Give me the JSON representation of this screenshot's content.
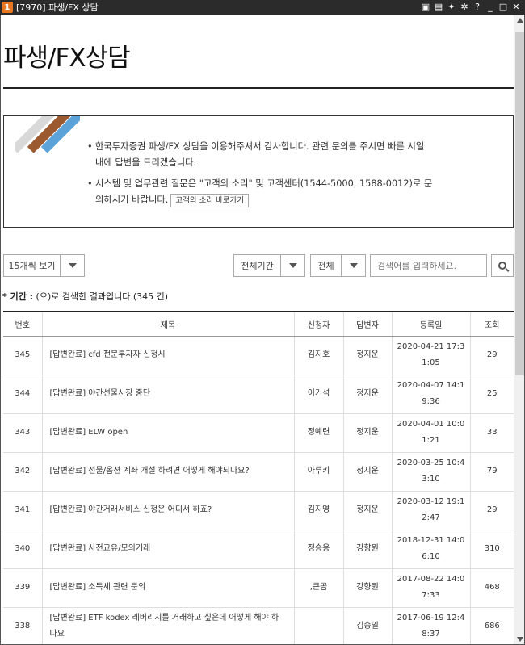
{
  "window": {
    "app_number": "1",
    "title": "[7970] 파생/FX 상담",
    "controls": [
      "▣",
      "▤",
      "✦",
      "✲",
      "?",
      "_",
      "□",
      "✕"
    ]
  },
  "page": {
    "title": "파생/FX상담"
  },
  "notice": {
    "line1": "한국투자증권 파생/FX 상담을 이용해주셔서 감사합니다. 관련 문의를 주시면 빠른 시일 내에 답변을 드리겠습니다.",
    "line2": "시스템 및 업무관련 질문은 \"고객의 소리\" 및 고객센터(1544-5000, 1588-0012)로 문의하시기 바랍니다.",
    "voice_button": "고객의 소리 바로가기"
  },
  "controls": {
    "page_size": "15개씩 보기",
    "period": "전체기간",
    "scope": "전체",
    "search_placeholder": "검색어를 입력하세요."
  },
  "result": {
    "label": "* 기간 :",
    "text": " (으)로 검색한 결과입니다.(345 건)"
  },
  "table": {
    "headers": {
      "no": "번호",
      "title": "제목",
      "applicant": "신청자",
      "answerer": "답변자",
      "date": "등록일",
      "views": "조회"
    },
    "rows": [
      {
        "no": "345",
        "title": "[답변완료] cfd 전문투자자 신청시",
        "title2": "",
        "applicant": "김지호",
        "answerer": "정지운",
        "date1": "2020-04-21 17:3",
        "date2": "1:05",
        "views": "29"
      },
      {
        "no": "344",
        "title": "[답변완료] 야간선물시장 중단",
        "title2": "",
        "applicant": "이기석",
        "answerer": "정지운",
        "date1": "2020-04-07 14:1",
        "date2": "9:36",
        "views": "25"
      },
      {
        "no": "343",
        "title": "[답변완료] ELW open",
        "title2": "",
        "applicant": "정예련",
        "answerer": "정지운",
        "date1": "2020-04-01 10:0",
        "date2": "1:21",
        "views": "33"
      },
      {
        "no": "342",
        "title": "[답변완료] 선물/옵션 계좌 개설 하려면 어떻게 해야되나요?",
        "title2": "",
        "applicant": "아루키",
        "answerer": "정지운",
        "date1": "2020-03-25 10:4",
        "date2": "3:10",
        "views": "79"
      },
      {
        "no": "341",
        "title": "[답변완료] 야간거래서비스 신청은 어디서 하죠?",
        "title2": "",
        "applicant": "김지영",
        "answerer": "정지운",
        "date1": "2020-03-12 19:1",
        "date2": "2:47",
        "views": "29"
      },
      {
        "no": "340",
        "title": "[답변완료] 사전교유/모의거래",
        "title2": "",
        "applicant": "정승용",
        "answerer": "강향원",
        "date1": "2018-12-31 14:0",
        "date2": "6:10",
        "views": "310"
      },
      {
        "no": "339",
        "title": "[답변완료] 소득세 관련 문의",
        "title2": "",
        "applicant": ",큰곰",
        "answerer": "강향원",
        "date1": "2017-08-22 14:0",
        "date2": "7:33",
        "views": "468"
      },
      {
        "no": "338",
        "title": "[답변완료] ETF kodex 레버리지를 거래하고 싶은데 어떻게 해야 하",
        "title2": "나요",
        "applicant": "",
        "answerer": "김승일",
        "date1": "2017-06-19 12:4",
        "date2": "8:37",
        "views": "686"
      }
    ]
  }
}
